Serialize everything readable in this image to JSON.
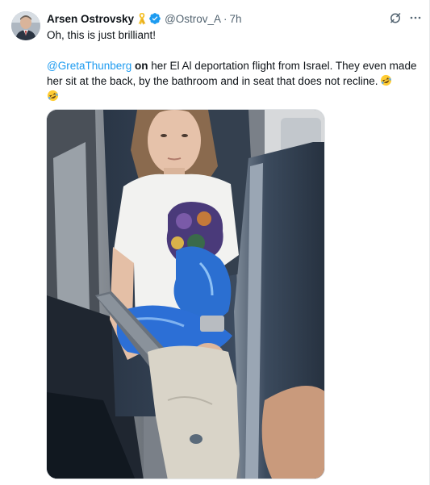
{
  "tweet": {
    "author": {
      "display_name": "Arsen Ostrovsky",
      "handle": "@Ostrov_A",
      "time_separator": "·",
      "time": "7h",
      "badges": [
        "yellow-ribbon-icon",
        "verified-badge-icon"
      ]
    },
    "text": {
      "line1": "Oh, this is just brilliant!",
      "mention": "@GretaThunberg",
      "bold_word": "on",
      "body": " her El Al deportation flight from Israel. They even made her sit at the back, by the bathroom and in seat that does not recline.",
      "emojis": [
        "rolling-on-floor-laughing-emoji",
        "rolling-on-floor-laughing-emoji"
      ]
    },
    "actions": {
      "grok": "grok-icon",
      "more": "more-options-icon"
    },
    "media": {
      "type": "photo",
      "subject": "person-in-airplane-seat"
    }
  },
  "colors": {
    "link": "#1d9bf0",
    "verified": "#1d9bf0",
    "ribbon": "#f7c948",
    "text": "#0f1419",
    "secondary": "#536471"
  }
}
